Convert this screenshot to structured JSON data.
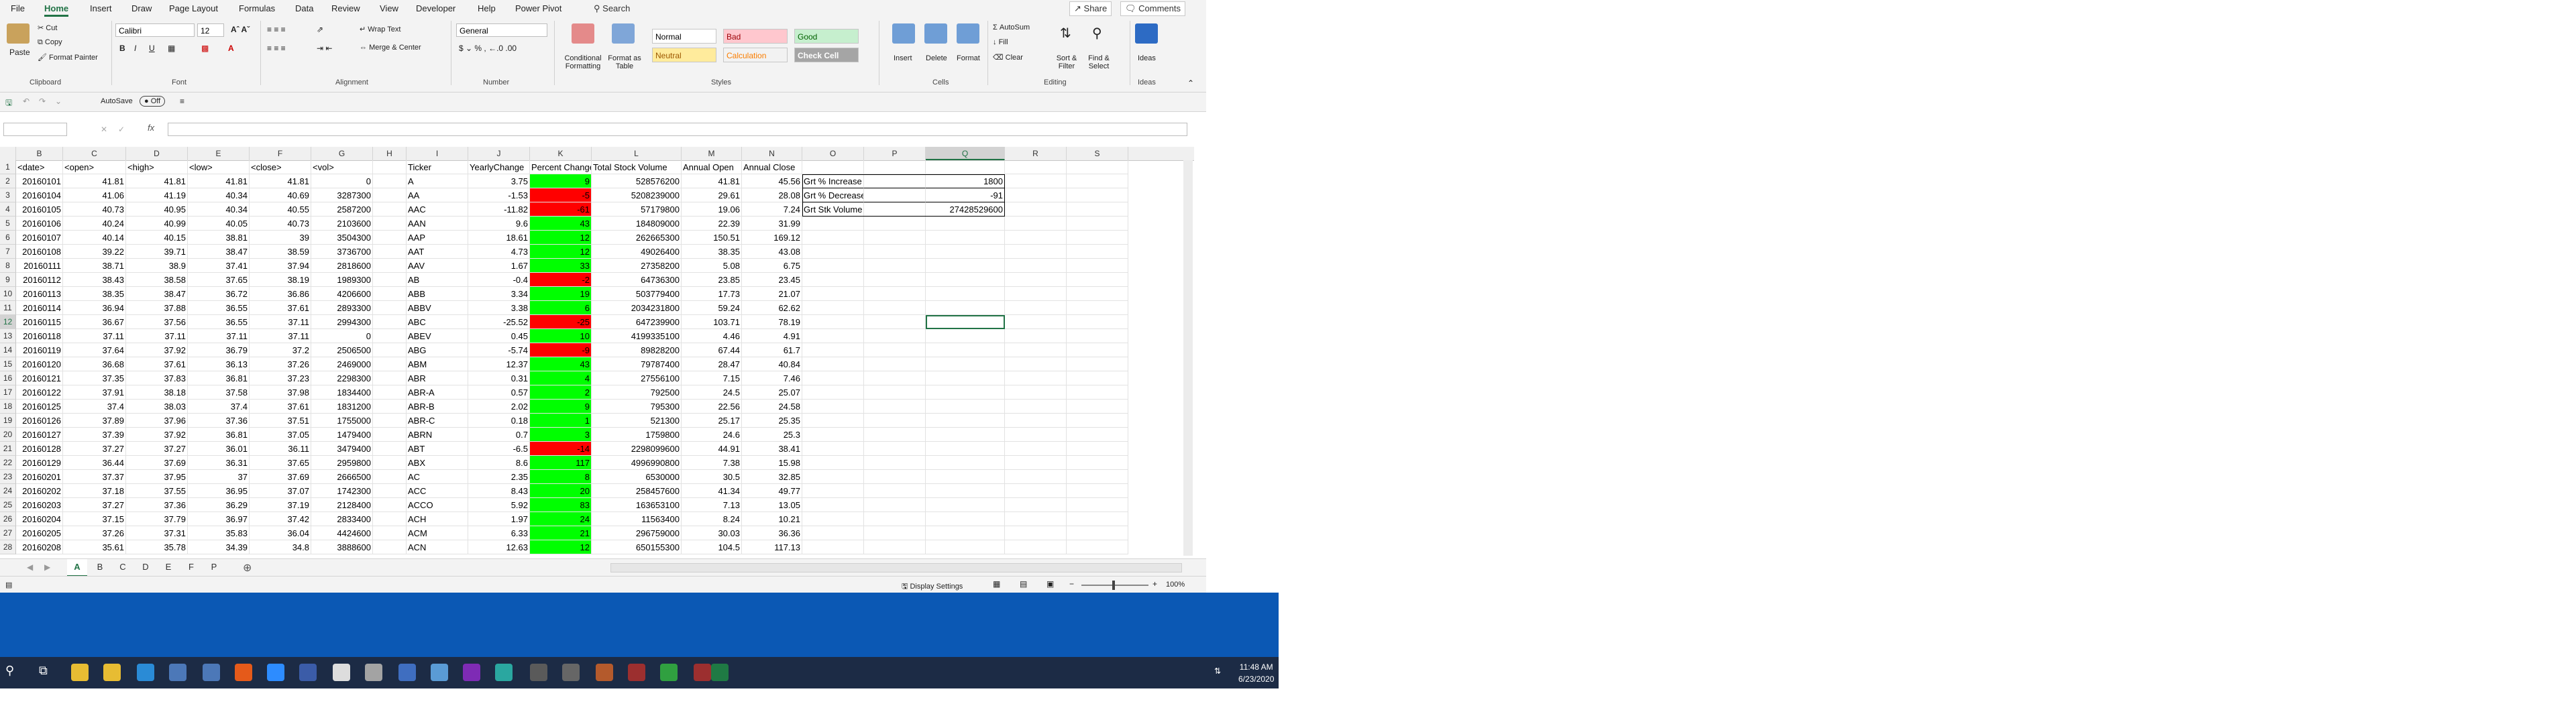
{
  "ribbon_tabs": [
    "File",
    "Home",
    "Insert",
    "Draw",
    "Page Layout",
    "Formulas",
    "Data",
    "Review",
    "View",
    "Developer",
    "Help",
    "Power Pivot"
  ],
  "search": {
    "label": "Search"
  },
  "share": "Share",
  "comments": "Comments",
  "clipboard": {
    "paste": "Paste",
    "cut": "Cut",
    "copy": "Copy",
    "format_painter": "Format Painter",
    "label": "Clipboard"
  },
  "font": {
    "name": "Calibri",
    "size": "12",
    "label": "Font"
  },
  "alignment": {
    "wrap": "Wrap Text",
    "merge": "Merge & Center",
    "label": "Alignment"
  },
  "number": {
    "format": "General",
    "label": "Number"
  },
  "styles": {
    "conditional": "Conditional Formatting",
    "format_table": "Format as Table",
    "normal": "Normal",
    "bad": "Bad",
    "good": "Good",
    "neutral": "Neutral",
    "calculation": "Calculation",
    "check_cell": "Check Cell",
    "label": "Styles"
  },
  "cells": {
    "insert": "Insert",
    "delete": "Delete",
    "format": "Format",
    "label": "Cells"
  },
  "editing": {
    "autosum": "AutoSum",
    "fill": "Fill",
    "clear": "Clear",
    "sort": "Sort & Filter",
    "find": "Find & Select",
    "label": "Editing"
  },
  "ideas": {
    "ideas": "Ideas",
    "label": "Ideas"
  },
  "qat": {
    "autosave": "AutoSave",
    "off": "Off"
  },
  "formula_bar": {
    "fx": "fx"
  },
  "columns": [
    "B",
    "C",
    "D",
    "E",
    "F",
    "G",
    "H",
    "I",
    "J",
    "K",
    "L",
    "M",
    "N",
    "O",
    "P",
    "Q",
    "R",
    "S"
  ],
  "headers": [
    "<date>",
    "<open>",
    "<high>",
    "<low>",
    "<close>",
    "<vol>",
    "",
    "Ticker",
    "YearlyChange",
    "Percent Change",
    "Total Stock Volume",
    "Annual Open",
    "Annual Close"
  ],
  "summary": [
    {
      "label": "Grt % Increase",
      "value": "1800"
    },
    {
      "label": "Grt % Decrease",
      "value": "-91"
    },
    {
      "label": "Grt Stk Volume",
      "value": "27428529600"
    }
  ],
  "rows": [
    [
      "20160101",
      "41.81",
      "41.81",
      "41.81",
      "41.81",
      "0",
      "",
      "A",
      "3.75",
      "9",
      "528576200",
      "41.81",
      "45.56"
    ],
    [
      "20160104",
      "41.06",
      "41.19",
      "40.34",
      "40.69",
      "3287300",
      "",
      "AA",
      "-1.53",
      "-5",
      "5208239000",
      "29.61",
      "28.08"
    ],
    [
      "20160105",
      "40.73",
      "40.95",
      "40.34",
      "40.55",
      "2587200",
      "",
      "AAC",
      "-11.82",
      "-61",
      "57179800",
      "19.06",
      "7.24"
    ],
    [
      "20160106",
      "40.24",
      "40.99",
      "40.05",
      "40.73",
      "2103600",
      "",
      "AAN",
      "9.6",
      "43",
      "184809000",
      "22.39",
      "31.99"
    ],
    [
      "20160107",
      "40.14",
      "40.15",
      "38.81",
      "39",
      "3504300",
      "",
      "AAP",
      "18.61",
      "12",
      "262665300",
      "150.51",
      "169.12"
    ],
    [
      "20160108",
      "39.22",
      "39.71",
      "38.47",
      "38.59",
      "3736700",
      "",
      "AAT",
      "4.73",
      "12",
      "49026400",
      "38.35",
      "43.08"
    ],
    [
      "20160111",
      "38.71",
      "38.9",
      "37.41",
      "37.94",
      "2818600",
      "",
      "AAV",
      "1.67",
      "33",
      "27358200",
      "5.08",
      "6.75"
    ],
    [
      "20160112",
      "38.43",
      "38.58",
      "37.65",
      "38.19",
      "1989300",
      "",
      "AB",
      "-0.4",
      "-2",
      "64736300",
      "23.85",
      "23.45"
    ],
    [
      "20160113",
      "38.35",
      "38.47",
      "36.72",
      "36.86",
      "4206600",
      "",
      "ABB",
      "3.34",
      "19",
      "503779400",
      "17.73",
      "21.07"
    ],
    [
      "20160114",
      "36.94",
      "37.88",
      "36.55",
      "37.61",
      "2893300",
      "",
      "ABBV",
      "3.38",
      "6",
      "2034231800",
      "59.24",
      "62.62"
    ],
    [
      "20160115",
      "36.67",
      "37.56",
      "36.55",
      "37.11",
      "2994300",
      "",
      "ABC",
      "-25.52",
      "-25",
      "647239900",
      "103.71",
      "78.19"
    ],
    [
      "20160118",
      "37.11",
      "37.11",
      "37.11",
      "37.11",
      "0",
      "",
      "ABEV",
      "0.45",
      "10",
      "4199335100",
      "4.46",
      "4.91"
    ],
    [
      "20160119",
      "37.64",
      "37.92",
      "36.79",
      "37.2",
      "2506500",
      "",
      "ABG",
      "-5.74",
      "-9",
      "89828200",
      "67.44",
      "61.7"
    ],
    [
      "20160120",
      "36.68",
      "37.61",
      "36.13",
      "37.26",
      "2469000",
      "",
      "ABM",
      "12.37",
      "43",
      "79787400",
      "28.47",
      "40.84"
    ],
    [
      "20160121",
      "37.35",
      "37.83",
      "36.81",
      "37.23",
      "2298300",
      "",
      "ABR",
      "0.31",
      "4",
      "27556100",
      "7.15",
      "7.46"
    ],
    [
      "20160122",
      "37.91",
      "38.18",
      "37.58",
      "37.98",
      "1834400",
      "",
      "ABR-A",
      "0.57",
      "2",
      "792500",
      "24.5",
      "25.07"
    ],
    [
      "20160125",
      "37.4",
      "38.03",
      "37.4",
      "37.61",
      "1831200",
      "",
      "ABR-B",
      "2.02",
      "9",
      "795300",
      "22.56",
      "24.58"
    ],
    [
      "20160126",
      "37.89",
      "37.96",
      "37.36",
      "37.51",
      "1755000",
      "",
      "ABR-C",
      "0.18",
      "1",
      "521300",
      "25.17",
      "25.35"
    ],
    [
      "20160127",
      "37.39",
      "37.92",
      "36.81",
      "37.05",
      "1479400",
      "",
      "ABRN",
      "0.7",
      "3",
      "1759800",
      "24.6",
      "25.3"
    ],
    [
      "20160128",
      "37.27",
      "37.27",
      "36.01",
      "36.11",
      "3479400",
      "",
      "ABT",
      "-6.5",
      "-14",
      "2298099600",
      "44.91",
      "38.41"
    ],
    [
      "20160129",
      "36.44",
      "37.69",
      "36.31",
      "37.65",
      "2959800",
      "",
      "ABX",
      "8.6",
      "117",
      "4996990800",
      "7.38",
      "15.98"
    ],
    [
      "20160201",
      "37.37",
      "37.95",
      "37",
      "37.69",
      "2666500",
      "",
      "AC",
      "2.35",
      "8",
      "6530000",
      "30.5",
      "32.85"
    ],
    [
      "20160202",
      "37.18",
      "37.55",
      "36.95",
      "37.07",
      "1742300",
      "",
      "ACC",
      "8.43",
      "20",
      "258457600",
      "41.34",
      "49.77"
    ],
    [
      "20160203",
      "37.27",
      "37.36",
      "36.29",
      "37.19",
      "2128400",
      "",
      "ACCO",
      "5.92",
      "83",
      "163653100",
      "7.13",
      "13.05"
    ],
    [
      "20160204",
      "37.15",
      "37.79",
      "36.97",
      "37.42",
      "2833400",
      "",
      "ACH",
      "1.97",
      "24",
      "11563400",
      "8.24",
      "10.21"
    ],
    [
      "20160205",
      "37.26",
      "37.31",
      "35.83",
      "36.04",
      "4424600",
      "",
      "ACM",
      "6.33",
      "21",
      "296759000",
      "30.03",
      "36.36"
    ],
    [
      "20160208",
      "35.61",
      "35.78",
      "34.39",
      "34.8",
      "3888600",
      "",
      "ACN",
      "12.63",
      "12",
      "650155300",
      "104.5",
      "117.13"
    ]
  ],
  "sheets": [
    "A",
    "B",
    "C",
    "D",
    "E",
    "F",
    "P"
  ],
  "status": {
    "display": "Display Settings",
    "zoom": "100%"
  },
  "clock": {
    "time": "11:48 AM",
    "date": "6/23/2020"
  },
  "colors": {
    "accent": "#217346",
    "green": "#00ff00",
    "red": "#ff0000",
    "taskbar": "#1c2b45"
  }
}
